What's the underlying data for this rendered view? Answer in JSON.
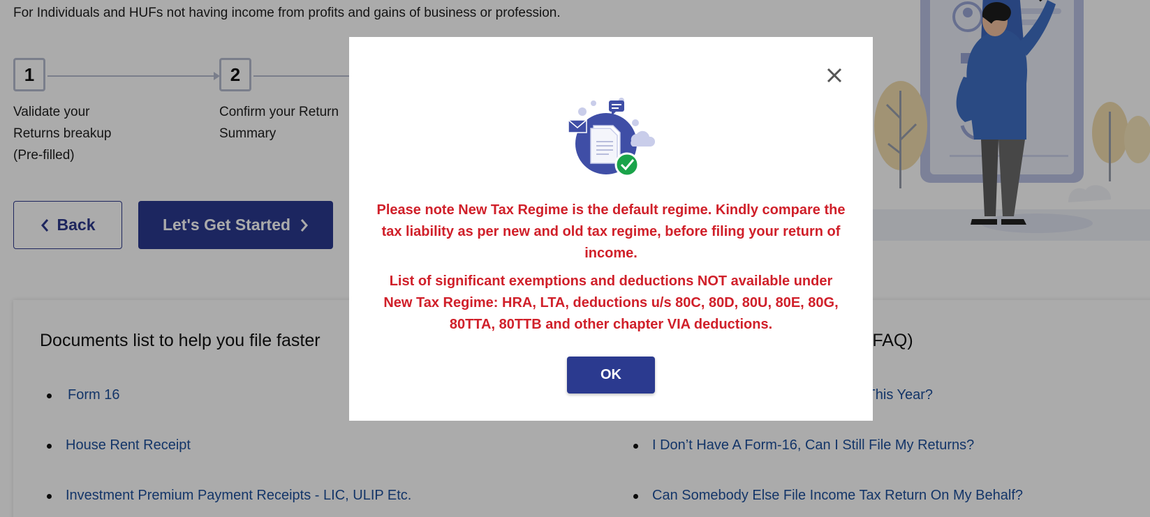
{
  "page": {
    "subtitle": "For Individuals and HUFs not having income from profits and gains of business or profession."
  },
  "steps": [
    {
      "number": "1",
      "label": "Validate your\nReturns breakup\n(Pre-filled)"
    },
    {
      "number": "2",
      "label": "Confirm your Return\nSummary"
    }
  ],
  "buttons": {
    "back_label": "Back",
    "start_label": "Let's Get Started"
  },
  "documents": {
    "heading": "Documents list to help you file faster",
    "items": [
      "Form 16",
      "House Rent Receipt",
      "Investment Premium Payment Receipts - LIC, ULIP Etc."
    ]
  },
  "faq": {
    "heading_suffix": "(FAQ)",
    "items": [
      "rns For This Year?",
      "I Don’t Have A Form-16, Can I Still File My Returns?",
      "Can Somebody Else File Income Tax Return On My Behalf?"
    ]
  },
  "modal": {
    "message_1": "Please note New Tax Regime is the default regime. Kindly compare the tax liability as per new and old tax regime, before filing your return of income.",
    "message_2": "List of significant exemptions and deductions NOT available under New Tax Regime: HRA, LTA, deductions u/s 80C, 80D, 80U, 80E, 80G, 80TTA, 80TTB and other chapter VIA deductions.",
    "ok_label": "OK",
    "icon": "document-check-icon",
    "close_icon": "close-icon"
  },
  "colors": {
    "primary": "#2b3a8f",
    "alert_text": "#d0202a",
    "link": "#1d4f9c",
    "success": "#1aa34a"
  }
}
